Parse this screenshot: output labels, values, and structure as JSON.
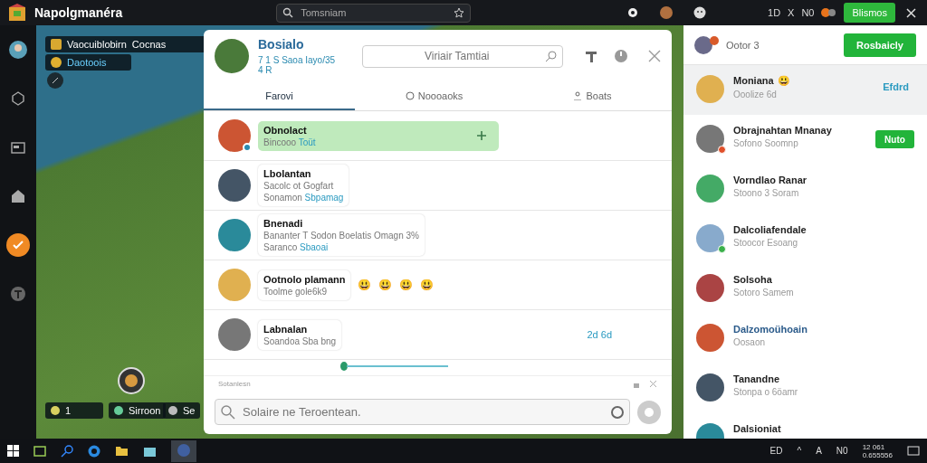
{
  "title_bar": {
    "app_name": "Napolgmanéra",
    "search_placeholder": "Tomsniam",
    "status": [
      "1D",
      "X",
      "N0"
    ],
    "button": "Blismos"
  },
  "sidebar": {
    "items": [
      {
        "kind": "avatar",
        "selected": false
      },
      {
        "kind": "hexagon",
        "selected": false
      },
      {
        "kind": "window",
        "selected": false
      },
      {
        "kind": "house",
        "selected": false
      },
      {
        "kind": "check",
        "selected": true
      },
      {
        "kind": "info",
        "selected": false
      }
    ]
  },
  "game_hud": {
    "quest": "Vaocuiblobirn",
    "quest_extra": "Cocnas",
    "location": "Daotoois",
    "bottom_items": [
      "1",
      "Sirroon",
      "Se"
    ]
  },
  "chat": {
    "title": "Bosialo",
    "status": "7 1 S Saoa Iayo/35 4 R",
    "search_placeholder": "Viriair Tamtiai",
    "tabs": [
      {
        "label": "Farovi",
        "selected": true
      },
      {
        "label": "Noooaoks",
        "selected": false
      },
      {
        "label": "Boats",
        "selected": false
      }
    ],
    "messages": [
      {
        "name": "Obnolact",
        "lines": [
          "Bincooo"
        ],
        "link": "Toüt",
        "highlighted": true,
        "online": true
      },
      {
        "name": "Lbolantan",
        "lines": [
          "Sacolc ot Gogfart",
          "Sonamon"
        ],
        "link": "Sbpamag",
        "highlighted": false,
        "online": false
      },
      {
        "name": "Bnenadi",
        "lines": [
          "Bananter T Sodon Boelatis Omagn 3%",
          "Saranco"
        ],
        "link": "Sbaoai",
        "highlighted": false,
        "online": false
      },
      {
        "name": "Ootnolo plamann",
        "lines": [
          "Toolme gole6k9"
        ],
        "reactions": [
          "😃",
          "😃",
          "😃",
          "😃"
        ],
        "highlighted": false,
        "online": false
      },
      {
        "name": "Labnalan",
        "lines": [
          "Soandoa Sba bng"
        ],
        "time": "2d 6d",
        "highlighted": false,
        "online": false
      }
    ],
    "composer": {
      "label": "Sotanlesn",
      "placeholder": "Solaire ne Teroentean."
    }
  },
  "contacts": {
    "title": "Ootor 3",
    "button": "Rosbaicly",
    "items": [
      {
        "name": "Moniana",
        "emoji": "😃",
        "status": "Ooolize 6d",
        "link": "Efdrd",
        "selected": true,
        "highlighted": false
      },
      {
        "name": "Obrajnahtan Mnanay",
        "status": "Sofono Soomnp",
        "button": "Nuto",
        "color": "#e0502a",
        "selected": false,
        "highlighted": false
      },
      {
        "name": "Vorndlao Ranar",
        "status": "Stoono 3 Soram",
        "selected": false,
        "highlighted": false
      },
      {
        "name": "Dalcoliafendale",
        "status": "Stoocor Esoang",
        "color": "#3ab04a",
        "selected": false,
        "highlighted": false
      },
      {
        "name": "Solsoha",
        "status": "Sotoro Samem",
        "selected": false,
        "highlighted": false
      },
      {
        "name": "Dalzomoühoain",
        "status": "Oosaon",
        "selected": false,
        "highlighted": true
      },
      {
        "name": "Tanandne",
        "status": "Stonpa o 6öamr",
        "selected": false,
        "highlighted": false
      },
      {
        "name": "Dalsioniat",
        "selected": false,
        "highlighted": false
      }
    ]
  },
  "taskbar": {
    "tray": [
      "ED",
      "^",
      "A",
      "N0"
    ],
    "clock": [
      "12 061",
      "0.655556"
    ]
  }
}
